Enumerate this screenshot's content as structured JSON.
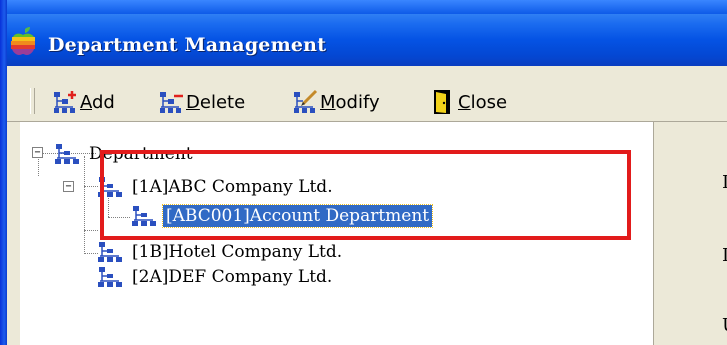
{
  "window": {
    "title": "Department Management"
  },
  "toolbar": {
    "buttons": [
      {
        "name": "add-button",
        "icon": "add-tree-icon",
        "label": "Add",
        "mnemonic": "A"
      },
      {
        "name": "delete-button",
        "icon": "delete-tree-icon",
        "label": "Delete",
        "mnemonic": "D"
      },
      {
        "name": "modify-button",
        "icon": "modify-tree-icon",
        "label": "Modify",
        "mnemonic": "M"
      },
      {
        "name": "close-button",
        "icon": "door-exit-icon",
        "label": "Close",
        "mnemonic": "C"
      }
    ]
  },
  "tree": {
    "root": {
      "label": "Department",
      "expanded": true
    },
    "nodes": [
      {
        "label": "[1A]ABC Company Ltd.",
        "expanded": true
      },
      {
        "label": "[ABC001]Account Department",
        "selected": true
      },
      {
        "label": "[1B]Hotel Company Ltd."
      },
      {
        "label": "[2A]DEF Company Ltd."
      }
    ]
  },
  "right_panel": {
    "labels": [
      "I",
      "I",
      "U"
    ]
  },
  "colors": {
    "title_bar": "#0553e4",
    "selection": "#316ac5",
    "highlight_box": "#e21b1b",
    "face": "#ece9d8"
  }
}
